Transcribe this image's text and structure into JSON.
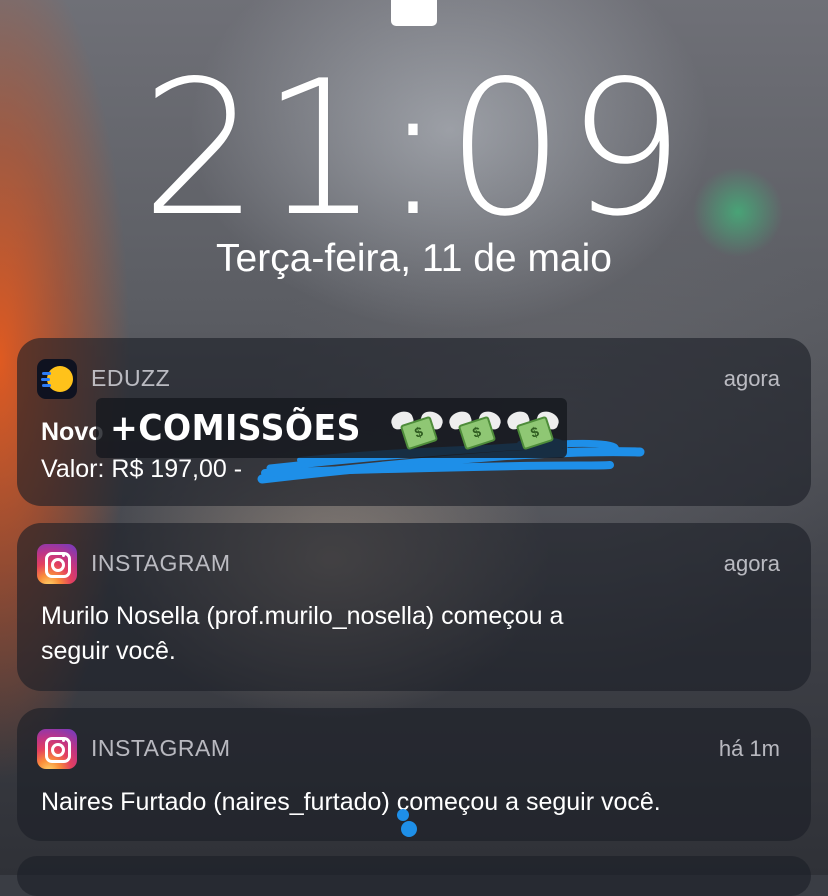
{
  "lockscreen": {
    "time": "21:09",
    "date": "Terça-feira, 11 de maio"
  },
  "notifications": [
    {
      "app": "EDUZZ",
      "icon": "eduzz-icon",
      "time": "agora",
      "title": "Novo",
      "body": "Valor: R$ 197,00 -"
    },
    {
      "app": "INSTAGRAM",
      "icon": "instagram-icon",
      "time": "agora",
      "body_line1": "Murilo Nosella (prof.murilo_nosella) começou a",
      "body_line2": "seguir você."
    },
    {
      "app": "INSTAGRAM",
      "icon": "instagram-icon",
      "time": "há 1m",
      "body": "Naires Furtado (naires_furtado) começou a seguir você."
    }
  ],
  "sticker": {
    "text": "+COMISSÕES",
    "emoji_icon": "money-with-wings-icon",
    "emoji_count": 3
  },
  "colors": {
    "card_bg": "rgba(28,30,38,0.62)",
    "scribble": "#1e8fe8",
    "eduzz_yellow": "#ffc21a"
  }
}
